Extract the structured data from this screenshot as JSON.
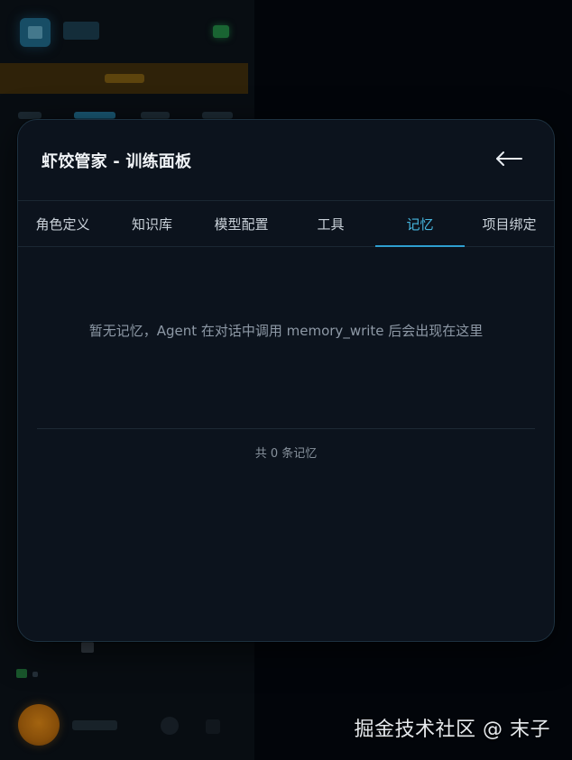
{
  "modal": {
    "title": "虾饺管家 - 训练面板",
    "back_icon": "arrow-left-icon"
  },
  "tabs": [
    {
      "label": "角色定义",
      "active": false
    },
    {
      "label": "知识库",
      "active": false
    },
    {
      "label": "模型配置",
      "active": false
    },
    {
      "label": "工具",
      "active": false
    },
    {
      "label": "记忆",
      "active": true
    },
    {
      "label": "项目绑定",
      "active": false
    }
  ],
  "memory": {
    "empty_message": "暂无记忆，Agent 在对话中调用 memory_write 后会出现在这里",
    "count_text": "共 0 条记忆"
  },
  "watermark": "掘金技术社区 @ 末子",
  "colors": {
    "accent": "#46b6df",
    "modal_bg": "#0c131d",
    "page_bg": "#03070d"
  }
}
